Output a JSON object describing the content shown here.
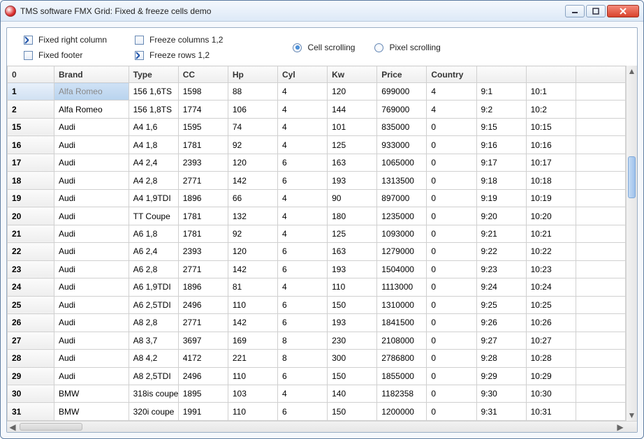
{
  "window": {
    "title": "TMS software FMX Grid: Fixed & freeze cells demo"
  },
  "controls": {
    "fixed_right_column": {
      "label": "Fixed right column",
      "checked": true
    },
    "fixed_footer": {
      "label": "Fixed footer",
      "checked": false
    },
    "freeze_columns": {
      "label": "Freeze columns 1,2",
      "checked": false
    },
    "freeze_rows": {
      "label": "Freeze rows 1,2",
      "checked": true
    },
    "cell_scrolling": {
      "label": "Cell scrolling",
      "checked": true
    },
    "pixel_scrolling": {
      "label": "Pixel scrolling",
      "checked": false
    }
  },
  "grid": {
    "headers": [
      "0",
      "Brand",
      "Type",
      "CC",
      "Hp",
      "Cyl",
      "Kw",
      "Price",
      "Country",
      "",
      "",
      ""
    ],
    "rows": [
      {
        "n": "1",
        "brand": "Alfa Romeo",
        "type": "156 1,6TS",
        "cc": "1598",
        "hp": "88",
        "cyl": "4",
        "kw": "120",
        "price": "699000",
        "country": "4",
        "c9": "9:1",
        "c10": "10:1",
        "selected": true
      },
      {
        "n": "2",
        "brand": "Alfa Romeo",
        "type": "156 1,8TS",
        "cc": "1774",
        "hp": "106",
        "cyl": "4",
        "kw": "144",
        "price": "769000",
        "country": "4",
        "c9": "9:2",
        "c10": "10:2"
      },
      {
        "n": "15",
        "brand": "Audi",
        "type": "A4 1,6",
        "cc": "1595",
        "hp": "74",
        "cyl": "4",
        "kw": "101",
        "price": "835000",
        "country": "0",
        "c9": "9:15",
        "c10": "10:15"
      },
      {
        "n": "16",
        "brand": "Audi",
        "type": "A4 1,8",
        "cc": "1781",
        "hp": "92",
        "cyl": "4",
        "kw": "125",
        "price": "933000",
        "country": "0",
        "c9": "9:16",
        "c10": "10:16"
      },
      {
        "n": "17",
        "brand": "Audi",
        "type": "A4 2,4",
        "cc": "2393",
        "hp": "120",
        "cyl": "6",
        "kw": "163",
        "price": "1065000",
        "country": "0",
        "c9": "9:17",
        "c10": "10:17"
      },
      {
        "n": "18",
        "brand": "Audi",
        "type": "A4 2,8",
        "cc": "2771",
        "hp": "142",
        "cyl": "6",
        "kw": "193",
        "price": "1313500",
        "country": "0",
        "c9": "9:18",
        "c10": "10:18"
      },
      {
        "n": "19",
        "brand": "Audi",
        "type": "A4 1,9TDI",
        "cc": "1896",
        "hp": "66",
        "cyl": "4",
        "kw": "90",
        "price": "897000",
        "country": "0",
        "c9": "9:19",
        "c10": "10:19"
      },
      {
        "n": "20",
        "brand": "Audi",
        "type": "TT Coupe",
        "cc": "1781",
        "hp": "132",
        "cyl": "4",
        "kw": "180",
        "price": "1235000",
        "country": "0",
        "c9": "9:20",
        "c10": "10:20"
      },
      {
        "n": "21",
        "brand": "Audi",
        "type": "A6 1,8",
        "cc": "1781",
        "hp": "92",
        "cyl": "4",
        "kw": "125",
        "price": "1093000",
        "country": "0",
        "c9": "9:21",
        "c10": "10:21"
      },
      {
        "n": "22",
        "brand": "Audi",
        "type": "A6 2,4",
        "cc": "2393",
        "hp": "120",
        "cyl": "6",
        "kw": "163",
        "price": "1279000",
        "country": "0",
        "c9": "9:22",
        "c10": "10:22"
      },
      {
        "n": "23",
        "brand": "Audi",
        "type": "A6 2,8",
        "cc": "2771",
        "hp": "142",
        "cyl": "6",
        "kw": "193",
        "price": "1504000",
        "country": "0",
        "c9": "9:23",
        "c10": "10:23"
      },
      {
        "n": "24",
        "brand": "Audi",
        "type": "A6 1,9TDI",
        "cc": "1896",
        "hp": "81",
        "cyl": "4",
        "kw": "110",
        "price": "1113000",
        "country": "0",
        "c9": "9:24",
        "c10": "10:24"
      },
      {
        "n": "25",
        "brand": "Audi",
        "type": "A6 2,5TDI",
        "cc": "2496",
        "hp": "110",
        "cyl": "6",
        "kw": "150",
        "price": "1310000",
        "country": "0",
        "c9": "9:25",
        "c10": "10:25"
      },
      {
        "n": "26",
        "brand": "Audi",
        "type": "A8 2,8",
        "cc": "2771",
        "hp": "142",
        "cyl": "6",
        "kw": "193",
        "price": "1841500",
        "country": "0",
        "c9": "9:26",
        "c10": "10:26"
      },
      {
        "n": "27",
        "brand": "Audi",
        "type": "A8 3,7",
        "cc": "3697",
        "hp": "169",
        "cyl": "8",
        "kw": "230",
        "price": "2108000",
        "country": "0",
        "c9": "9:27",
        "c10": "10:27"
      },
      {
        "n": "28",
        "brand": "Audi",
        "type": "A8 4,2",
        "cc": "4172",
        "hp": "221",
        "cyl": "8",
        "kw": "300",
        "price": "2786800",
        "country": "0",
        "c9": "9:28",
        "c10": "10:28"
      },
      {
        "n": "29",
        "brand": "Audi",
        "type": "A8 2,5TDI",
        "cc": "2496",
        "hp": "110",
        "cyl": "6",
        "kw": "150",
        "price": "1855000",
        "country": "0",
        "c9": "9:29",
        "c10": "10:29"
      },
      {
        "n": "30",
        "brand": "BMW",
        "type": "318is coupe",
        "cc": "1895",
        "hp": "103",
        "cyl": "4",
        "kw": "140",
        "price": "1182358",
        "country": "0",
        "c9": "9:30",
        "c10": "10:30"
      },
      {
        "n": "31",
        "brand": "BMW",
        "type": "320i coupe",
        "cc": "1991",
        "hp": "110",
        "cyl": "6",
        "kw": "150",
        "price": "1200000",
        "country": "0",
        "c9": "9:31",
        "c10": "10:31"
      }
    ]
  }
}
